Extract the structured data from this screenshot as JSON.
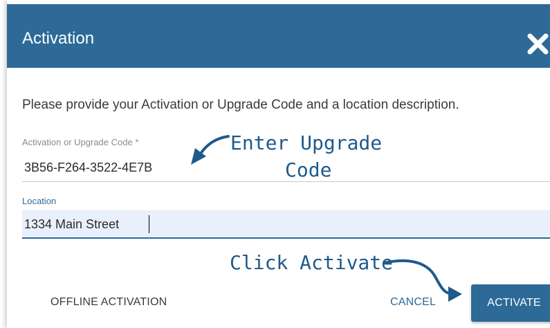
{
  "dialog": {
    "title": "Activation",
    "close_icon": "close-x-icon",
    "instructions": "Please provide your Activation or Upgrade Code and a location description."
  },
  "fields": {
    "code": {
      "label": "Activation or Upgrade Code *",
      "value": "3B56-F264-3522-4E7B"
    },
    "location": {
      "label": "Location",
      "value": "1334 Main Street"
    }
  },
  "annotations": {
    "enter_line1": "Enter Upgrade",
    "enter_line2": "Code",
    "click": "Click Activate"
  },
  "buttons": {
    "offline": "OFFLINE ACTIVATION",
    "cancel": "CANCEL",
    "activate": "ACTIVATE"
  },
  "colors": {
    "header": "#2d6a98",
    "accent": "#2d6a98",
    "annotation": "#1e5a8c",
    "location_bg": "#e8f0fb"
  }
}
